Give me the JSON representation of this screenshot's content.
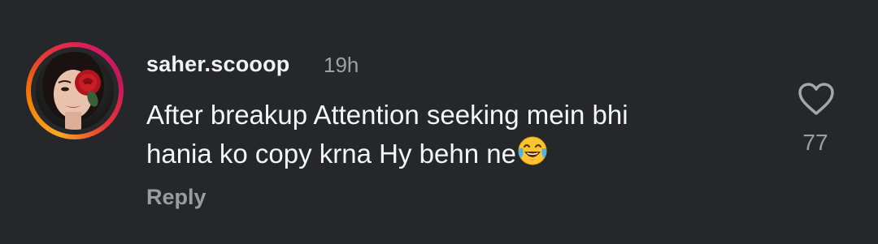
{
  "comment": {
    "username": "saher.scooop",
    "timestamp": "19h",
    "text_line1": "After breakup Attention seeking mein bhi",
    "text_line2": "hania ko copy krna Hy behn ne",
    "emoji": "face-with-tears-of-joy",
    "reply_label": "Reply",
    "like_count": "77",
    "like_icon": "heart-outline-icon"
  },
  "colors": {
    "background": "#26272b",
    "primary_text": "#f5f5f5",
    "secondary_text": "#a0a0a4",
    "story_ring": [
      "#f9a825",
      "#e53935",
      "#d81b60"
    ]
  }
}
